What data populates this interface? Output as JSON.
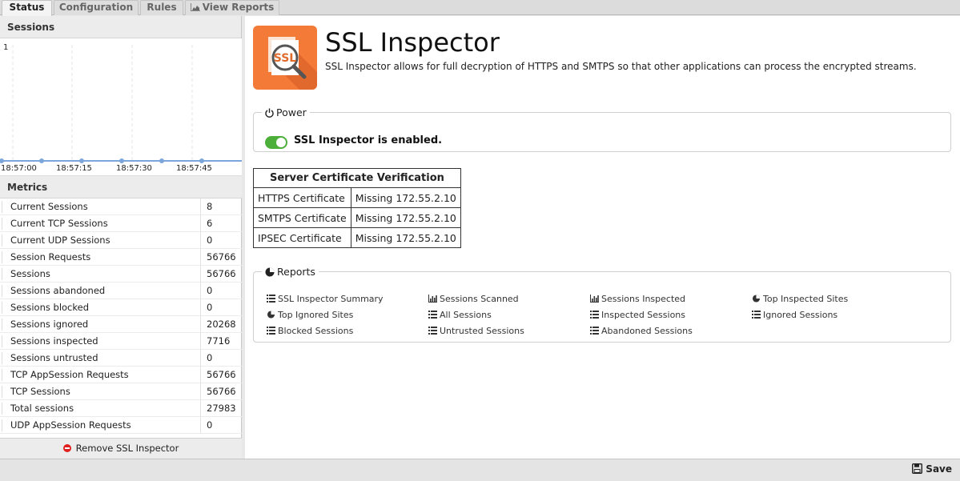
{
  "tabs": [
    {
      "label": "Status",
      "active": true
    },
    {
      "label": "Configuration",
      "active": false
    },
    {
      "label": "Rules",
      "active": false
    },
    {
      "label": "View Reports",
      "active": false,
      "icon": "area-chart-icon"
    }
  ],
  "sessions_panel": {
    "title": "Sessions",
    "chart": {
      "y_max_label": "1",
      "x_ticks": [
        "18:57:00",
        "18:57:15",
        "18:57:30",
        "18:57:45"
      ],
      "point_values": [
        0,
        0,
        0,
        0,
        0,
        0
      ],
      "line_color": "#7aa6dc"
    }
  },
  "metrics_panel": {
    "title": "Metrics",
    "rows": [
      {
        "name": "Current Sessions",
        "value": "8"
      },
      {
        "name": "Current TCP Sessions",
        "value": "6"
      },
      {
        "name": "Current UDP Sessions",
        "value": "0"
      },
      {
        "name": "Session Requests",
        "value": "56766"
      },
      {
        "name": "Sessions",
        "value": "56766"
      },
      {
        "name": "Sessions abandoned",
        "value": "0"
      },
      {
        "name": "Sessions blocked",
        "value": "0"
      },
      {
        "name": "Sessions ignored",
        "value": "20268"
      },
      {
        "name": "Sessions inspected",
        "value": "7716"
      },
      {
        "name": "Sessions untrusted",
        "value": "0"
      },
      {
        "name": "TCP AppSession Requests",
        "value": "56766"
      },
      {
        "name": "TCP Sessions",
        "value": "56766"
      },
      {
        "name": "Total sessions",
        "value": "27983"
      },
      {
        "name": "UDP AppSession Requests",
        "value": "0"
      }
    ],
    "remove_label": "Remove SSL Inspector"
  },
  "app": {
    "title": "SSL Inspector",
    "description": "SSL Inspector allows for full decryption of HTTPS and SMTPS so that other applications can process the encrypted streams.",
    "brand_color": "#f47a38",
    "logo_text": "SSL"
  },
  "power": {
    "legend": "Power",
    "status_text": "SSL Inspector is enabled.",
    "toggle_color": "#4caf3a"
  },
  "cert_verification": {
    "title": "Server Certificate Verification",
    "rows": [
      {
        "name": "HTTPS Certificate",
        "status": "Missing 172.55.2.10"
      },
      {
        "name": "SMTPS Certificate",
        "status": "Missing 172.55.2.10"
      },
      {
        "name": "IPSEC Certificate",
        "status": "Missing 172.55.2.10"
      }
    ]
  },
  "reports": {
    "legend": "Reports",
    "items": [
      {
        "label": "SSL Inspector Summary",
        "icon": "list-icon"
      },
      {
        "label": "Sessions Scanned",
        "icon": "bar-chart-icon"
      },
      {
        "label": "Sessions Inspected",
        "icon": "bar-chart-icon"
      },
      {
        "label": "Top Inspected Sites",
        "icon": "pie-chart-icon"
      },
      {
        "label": "Top Ignored Sites",
        "icon": "pie-chart-icon"
      },
      {
        "label": "All Sessions",
        "icon": "list-icon"
      },
      {
        "label": "Inspected Sessions",
        "icon": "list-icon"
      },
      {
        "label": "Ignored Sessions",
        "icon": "list-icon"
      },
      {
        "label": "Blocked Sessions",
        "icon": "list-icon"
      },
      {
        "label": "Untrusted Sessions",
        "icon": "list-icon"
      },
      {
        "label": "Abandoned Sessions",
        "icon": "list-icon"
      }
    ]
  },
  "footer": {
    "save_label": "Save"
  }
}
